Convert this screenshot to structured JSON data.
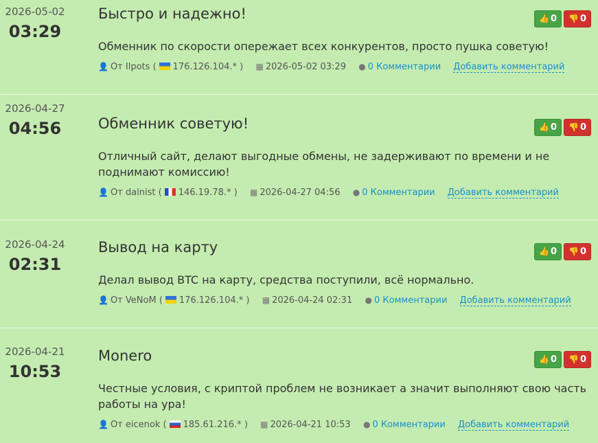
{
  "reviews": [
    {
      "date": "2026-05-02",
      "time": "03:29",
      "title": "Быстро и надежно!",
      "text": "Обменник по скорости опережает всех конкурентов, просто пушка советую!",
      "author_prefix": "От",
      "author": "Ilpots",
      "ip": "176.126.104.*",
      "flag": "ua",
      "datetime": "2026-05-02 03:29",
      "comments": "0 Комментарии",
      "add_comment": "Добавить комментарий",
      "up": "0",
      "down": "0"
    },
    {
      "date": "2026-04-27",
      "time": "04:56",
      "title": "Обменник советую!",
      "text": "Отличный сайт, делают выгодные обмены, не задерживают по времени и не поднимают комиссию!",
      "author_prefix": "От",
      "author": "dalnist",
      "ip": "146.19.78.*",
      "flag": "fr",
      "datetime": "2026-04-27 04:56",
      "comments": "0 Комментарии",
      "add_comment": "Добавить комментарий",
      "up": "0",
      "down": "0"
    },
    {
      "date": "2026-04-24",
      "time": "02:31",
      "title": "Вывод на карту",
      "text": "Делал вывод BTC на карту, средства поступили, всё нормально.",
      "author_prefix": "От",
      "author": "VeNoM",
      "ip": "176.126.104.*",
      "flag": "ua",
      "datetime": "2026-04-24 02:31",
      "comments": "0 Комментарии",
      "add_comment": "Добавить комментарий",
      "up": "0",
      "down": "0"
    },
    {
      "date": "2026-04-21",
      "time": "10:53",
      "title": "Monero",
      "text": "Честные условия, с криптой проблем не возникает а значит выполняют свою часть работы на ура!",
      "author_prefix": "От",
      "author": "eicenok",
      "ip": "185.61.216.*",
      "flag": "ru",
      "datetime": "2026-04-21 10:53",
      "comments": "0 Комментарии",
      "add_comment": "Добавить комментарий",
      "up": "0",
      "down": "0"
    }
  ],
  "icons": {
    "user": "user-icon",
    "calendar": "calendar-icon",
    "comments": "comments-icon",
    "thumbs_up": "thumbs-up-icon",
    "thumbs_down": "thumbs-down-icon"
  },
  "colors": {
    "background": "#c4ecb0",
    "up_button": "#47a447",
    "down_button": "#d2322d",
    "link": "#1a8fc9"
  }
}
